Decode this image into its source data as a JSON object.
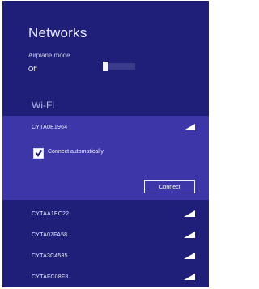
{
  "header": {
    "title": "Networks"
  },
  "airplane_mode": {
    "label": "Airplane mode",
    "state": "Off",
    "on": false
  },
  "wifi": {
    "section_title": "Wi-Fi",
    "selected_network": {
      "name": "CYTA0E1964",
      "signal_icon": "wifi-signal-icon",
      "connect_automatically_label": "Connect automatically",
      "connect_automatically_checked": true,
      "connect_button_label": "Connect"
    },
    "networks": [
      {
        "name": "CYTAA1EC22",
        "signal_icon": "wifi-signal-icon"
      },
      {
        "name": "CYTA07FA58",
        "signal_icon": "wifi-signal-icon"
      },
      {
        "name": "CYTA3C4535",
        "signal_icon": "wifi-signal-icon"
      },
      {
        "name": "CYTAFC08F8",
        "signal_icon": "wifi-signal-icon"
      }
    ]
  },
  "colors": {
    "panel_background": "#1f1f79",
    "selected_background": "#3c36a8",
    "text": "#ffffff"
  }
}
